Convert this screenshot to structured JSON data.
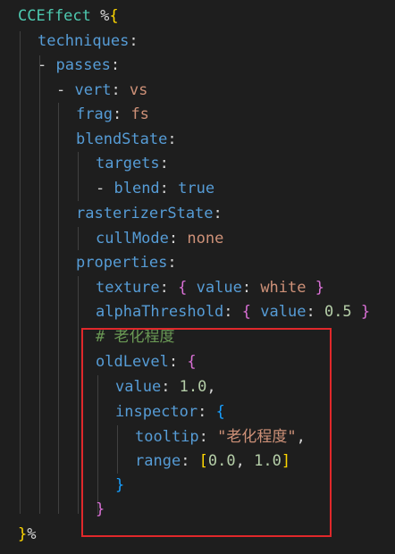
{
  "colors": {
    "background": "#1e1e1e",
    "key": "#569cd6",
    "teal": "#4ec9b0",
    "string": "#ce9178",
    "number": "#b5cea8",
    "comment": "#6a9955",
    "punct": "#d4d4d4",
    "bracket_yellow": "#ffd700",
    "bracket_magenta": "#da70d6",
    "bracket_blue": "#179fff",
    "highlight": "#e0282b"
  },
  "lines": [
    {
      "tokens": [
        {
          "t": "CCEffect",
          "c": "teal"
        },
        {
          "t": " %",
          "c": "punct"
        },
        {
          "t": "{",
          "c": "bracket_yellow"
        }
      ]
    },
    {
      "tokens": [
        {
          "t": "techniques",
          "c": "key"
        },
        {
          "t": ":",
          "c": "punct"
        }
      ]
    },
    {
      "tokens": [
        {
          "t": "- ",
          "c": "punct"
        },
        {
          "t": "passes",
          "c": "key"
        },
        {
          "t": ":",
          "c": "punct"
        }
      ]
    },
    {
      "tokens": [
        {
          "t": "- ",
          "c": "punct"
        },
        {
          "t": "vert",
          "c": "key"
        },
        {
          "t": ": ",
          "c": "punct"
        },
        {
          "t": "vs",
          "c": "string"
        }
      ]
    },
    {
      "tokens": [
        {
          "t": "frag",
          "c": "key"
        },
        {
          "t": ": ",
          "c": "punct"
        },
        {
          "t": "fs",
          "c": "string"
        }
      ]
    },
    {
      "tokens": [
        {
          "t": "blendState",
          "c": "key"
        },
        {
          "t": ":",
          "c": "punct"
        }
      ]
    },
    {
      "tokens": [
        {
          "t": "targets",
          "c": "key"
        },
        {
          "t": ":",
          "c": "punct"
        }
      ]
    },
    {
      "tokens": [
        {
          "t": "- ",
          "c": "punct"
        },
        {
          "t": "blend",
          "c": "key"
        },
        {
          "t": ": ",
          "c": "punct"
        },
        {
          "t": "true",
          "c": "key"
        }
      ]
    },
    {
      "tokens": [
        {
          "t": "rasterizerState",
          "c": "key"
        },
        {
          "t": ":",
          "c": "punct"
        }
      ]
    },
    {
      "tokens": [
        {
          "t": "cullMode",
          "c": "key"
        },
        {
          "t": ": ",
          "c": "punct"
        },
        {
          "t": "none",
          "c": "string"
        }
      ]
    },
    {
      "tokens": [
        {
          "t": "properties",
          "c": "key"
        },
        {
          "t": ":",
          "c": "punct"
        }
      ]
    },
    {
      "tokens": [
        {
          "t": "texture",
          "c": "key"
        },
        {
          "t": ": ",
          "c": "punct"
        },
        {
          "t": "{",
          "c": "bracket_magenta"
        },
        {
          "t": " ",
          "c": "punct"
        },
        {
          "t": "value",
          "c": "key"
        },
        {
          "t": ": ",
          "c": "punct"
        },
        {
          "t": "white",
          "c": "string"
        },
        {
          "t": " ",
          "c": "punct"
        },
        {
          "t": "}",
          "c": "bracket_magenta"
        }
      ]
    },
    {
      "tokens": [
        {
          "t": "alphaThreshold",
          "c": "key"
        },
        {
          "t": ": ",
          "c": "punct"
        },
        {
          "t": "{",
          "c": "bracket_magenta"
        },
        {
          "t": " ",
          "c": "punct"
        },
        {
          "t": "value",
          "c": "key"
        },
        {
          "t": ": ",
          "c": "punct"
        },
        {
          "t": "0.5",
          "c": "number"
        },
        {
          "t": " ",
          "c": "punct"
        },
        {
          "t": "}",
          "c": "bracket_magenta"
        }
      ]
    },
    {
      "tokens": [
        {
          "t": "# 老化程度",
          "c": "comment"
        }
      ]
    },
    {
      "tokens": [
        {
          "t": "oldLevel",
          "c": "key"
        },
        {
          "t": ": ",
          "c": "punct"
        },
        {
          "t": "{",
          "c": "bracket_magenta"
        }
      ]
    },
    {
      "tokens": [
        {
          "t": "value",
          "c": "key"
        },
        {
          "t": ": ",
          "c": "punct"
        },
        {
          "t": "1.0",
          "c": "number"
        },
        {
          "t": ",",
          "c": "punct"
        }
      ]
    },
    {
      "tokens": [
        {
          "t": "inspector",
          "c": "key"
        },
        {
          "t": ": ",
          "c": "punct"
        },
        {
          "t": "{",
          "c": "bracket_blue"
        }
      ]
    },
    {
      "tokens": [
        {
          "t": "tooltip",
          "c": "key"
        },
        {
          "t": ": ",
          "c": "punct"
        },
        {
          "t": "\"老化程度\"",
          "c": "string"
        },
        {
          "t": ",",
          "c": "punct"
        }
      ]
    },
    {
      "tokens": [
        {
          "t": "range",
          "c": "key"
        },
        {
          "t": ": ",
          "c": "punct"
        },
        {
          "t": "[",
          "c": "bracket_yellow"
        },
        {
          "t": "0.0",
          "c": "number"
        },
        {
          "t": ", ",
          "c": "punct"
        },
        {
          "t": "1.0",
          "c": "number"
        },
        {
          "t": "]",
          "c": "bracket_yellow"
        }
      ]
    },
    {
      "tokens": [
        {
          "t": "}",
          "c": "bracket_blue"
        }
      ]
    },
    {
      "tokens": [
        {
          "t": "}",
          "c": "bracket_magenta"
        }
      ]
    },
    {
      "tokens": []
    },
    {
      "tokens": [
        {
          "t": "}",
          "c": "bracket_yellow"
        },
        {
          "t": "%",
          "c": "punct"
        }
      ]
    }
  ]
}
